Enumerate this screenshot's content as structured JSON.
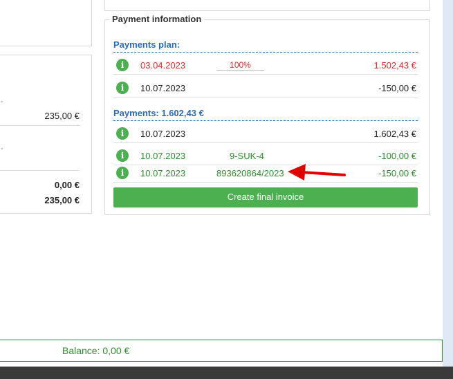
{
  "payment_info": {
    "legend": "Payment information",
    "plan_title": "Payments plan:",
    "plan_rows": [
      {
        "date": "03.04.2023",
        "percent": "100%",
        "amount": "1.502,43 €",
        "color": "#d32f2f"
      },
      {
        "date": "10.07.2023",
        "percent": "",
        "amount": "-150,00 €",
        "color": "#222222"
      }
    ],
    "payments_title": "Payments: 1.602,43 €",
    "payment_rows": [
      {
        "date": "10.07.2023",
        "ref": "",
        "amount": "1.602,43 €"
      },
      {
        "date": "10.07.2023",
        "ref": "9-SUK-4",
        "amount": "-100,00 €"
      },
      {
        "date": "10.07.2023",
        "ref": "893620864/2023",
        "amount": "-150,00 €"
      }
    ],
    "create_button": "Create final invoice"
  },
  "left_panel": {
    "dash1": "-",
    "value1": "235,00 €",
    "dash2": "-",
    "total1": "0,00 €",
    "total2": "235,00 €"
  },
  "balance": "Balance: 0,00 €",
  "info_icon_glyph": "i",
  "colors": {
    "green": "#4caf50",
    "red": "#d32f2f",
    "accent_blue": "#2b6cb0",
    "arrow": "#e00000"
  }
}
